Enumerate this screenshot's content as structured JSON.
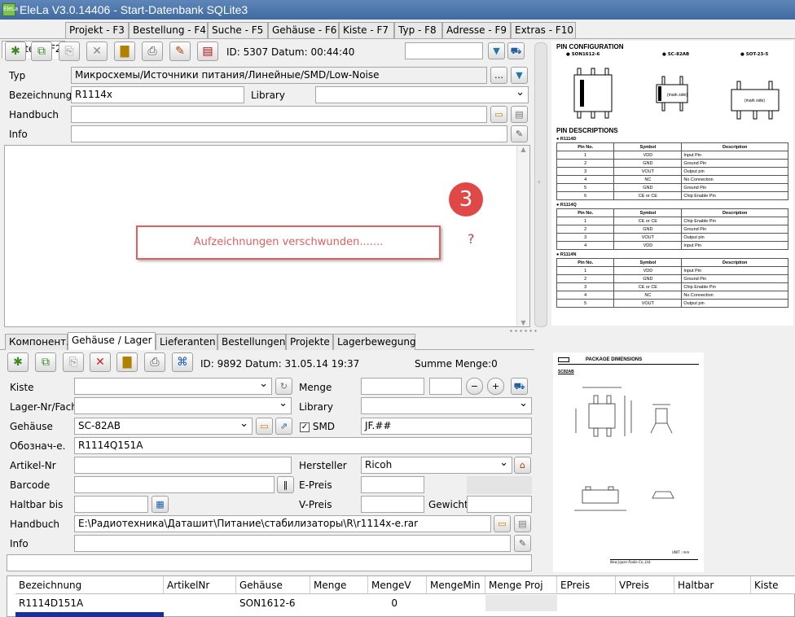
{
  "window": {
    "icon_text": "EleLa",
    "title": "EleLa V3.0.14406  - Start-Datenbank SQLite3"
  },
  "main_tabs": [
    "Bauteil - F2",
    "Projekt - F3",
    "Bestellung - F4",
    "Suche - F5",
    "Gehäuse - F6",
    "Kiste - F7",
    "Typ - F8",
    "Adresse - F9",
    "Extras - F10"
  ],
  "bauteil": {
    "id_text": "ID: 5307  Datum: 00:44:40",
    "typ_label": "Typ",
    "typ_value": "Микросхемы/Источники питания/Линейные/SMD/Low-Noise",
    "bez_label": "Bezeichnung",
    "bez_value": "R1114x",
    "library_label": "Library",
    "library_value": "",
    "handbuch_label": "Handbuch",
    "handbuch_value": "",
    "info_label": "Info",
    "info_value": "",
    "search_value": ""
  },
  "annotation": {
    "popup_text": "Aufzeichnungen verschwunden.......",
    "badge_number": "3",
    "question": "?"
  },
  "pin_config": {
    "title": "PIN CONFIGURATION",
    "packages": [
      "● SON1612-6",
      "● SC-82AB",
      "● SOT-23-5"
    ],
    "mark_side": "(mark side)",
    "desc_title": "PIN DESCRIPTIONS",
    "headers": [
      "Pin No.",
      "Symbol",
      "Description"
    ],
    "tables": [
      {
        "name": "● R1114D",
        "rows": [
          [
            "1",
            "VDD",
            "Input Pin"
          ],
          [
            "2",
            "GND",
            "Ground Pin"
          ],
          [
            "3",
            "VOUT",
            "Output pin"
          ],
          [
            "4",
            "NC",
            "No Connection"
          ],
          [
            "5",
            "GND",
            "Ground Pin"
          ],
          [
            "6",
            "CE or CE",
            "Chip Enable Pin"
          ]
        ]
      },
      {
        "name": "● R1114Q",
        "rows": [
          [
            "1",
            "CE or CE",
            "Chip Enable Pin"
          ],
          [
            "2",
            "GND",
            "Ground Pin"
          ],
          [
            "3",
            "VOUT",
            "Output pin"
          ],
          [
            "4",
            "VDD",
            "Input Pin"
          ]
        ]
      },
      {
        "name": "● R1114N",
        "rows": [
          [
            "1",
            "VDD",
            "Input Pin"
          ],
          [
            "2",
            "GND",
            "Ground Pin"
          ],
          [
            "3",
            "CE or CE",
            "Chip Enable Pin"
          ],
          [
            "4",
            "NC",
            "No Connection"
          ],
          [
            "5",
            "VOUT",
            "Output pin"
          ]
        ]
      }
    ]
  },
  "sub_tabs": [
    "Компонент.",
    "Gehäuse / Lager",
    "Lieferanten",
    "Bestellungen",
    "Projekte",
    "Lagerbewegung"
  ],
  "lager": {
    "id_text": "ID: 9892  Datum: 31.05.14 19:37",
    "summe": "Summe Menge:0",
    "kiste_label": "Kiste",
    "kiste_value": "",
    "menge_label": "Menge",
    "menge_value": "",
    "menge_step": "",
    "lagernr_label": "Lager-Nr/Fach",
    "lagernr_value": "",
    "library_label": "Library",
    "library_value": "",
    "gehaeuse_label": "Gehäuse",
    "gehaeuse_value": "SC-82AB",
    "smd_label": "SMD",
    "smd_checked": "✓",
    "smd_value": "JF.##",
    "oboz_label": "Обознач-е.",
    "oboz_value": "R1114Q151A",
    "artikel_label": "Artikel-Nr",
    "artikel_value": "",
    "hersteller_label": "Hersteller",
    "hersteller_value": "Ricoh",
    "barcode_label": "Barcode",
    "barcode_value": "",
    "epreis_label": "E-Preis",
    "epreis_value": "",
    "haltbar_label": "Haltbar bis",
    "haltbar_value": "",
    "vpreis_label": "V-Preis",
    "vpreis_value": "",
    "gewicht_label": "Gewicht",
    "gewicht_value": "",
    "handbuch_label": "Handbuch",
    "handbuch_value": "E:\\Радиотехника\\Даташит\\Питание\\стабилизаторы\\R\\r1114x-e.rar",
    "info_label": "Info",
    "info_value": ""
  },
  "pkg_dims": {
    "title": "PACKAGE DIMENSIONS",
    "pkg": "SC82AB",
    "unit": "UNIT : mm",
    "footer": "New Japan Radio Co.,Ltd."
  },
  "grid": {
    "headers": [
      "Bezeichnung",
      "ArtikelNr",
      "Gehäuse",
      "Menge",
      "MengeV",
      "MengeMin",
      "Menge Proj",
      "EPreis",
      "VPreis",
      "Haltbar",
      "Kiste"
    ],
    "rows": [
      [
        "R1114D151A",
        "",
        "SON1612-6",
        "",
        "0",
        "",
        "",
        "",
        "",
        "",
        ""
      ]
    ]
  }
}
